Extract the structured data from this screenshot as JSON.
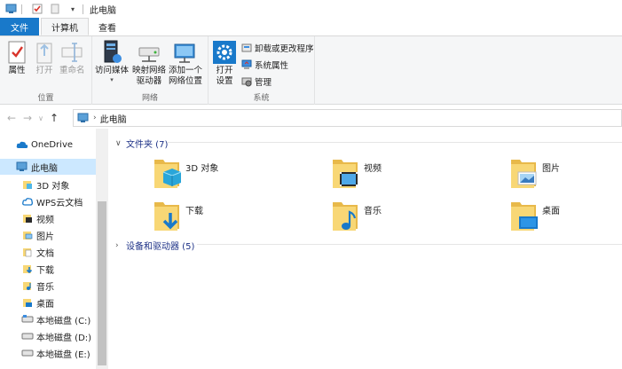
{
  "window": {
    "title": "此电脑"
  },
  "tabs": {
    "file": "文件",
    "computer": "计算机",
    "view": "查看"
  },
  "ribbon": {
    "location_group": {
      "label": "位置",
      "properties": "属性",
      "open": "打开",
      "rename": "重命名"
    },
    "network_group": {
      "label": "网络",
      "media": "访问媒体",
      "map_drive_line1": "映射网络",
      "map_drive_line2": "驱动器",
      "add_location_line1": "添加一个",
      "add_location_line2": "网络位置"
    },
    "system_group": {
      "label": "系统",
      "open_settings_line1": "打开",
      "open_settings_line2": "设置",
      "uninstall": "卸载或更改程序",
      "sys_props": "系统属性",
      "manage": "管理"
    }
  },
  "address": {
    "path": "此电脑"
  },
  "nav": {
    "onedrive": "OneDrive",
    "thispc": "此电脑",
    "items": [
      {
        "label": "3D 对象",
        "icon": "3d-objects-icon"
      },
      {
        "label": "WPS云文档",
        "icon": "wps-cloud-icon"
      },
      {
        "label": "视频",
        "icon": "videos-icon"
      },
      {
        "label": "图片",
        "icon": "pictures-icon"
      },
      {
        "label": "文档",
        "icon": "documents-icon"
      },
      {
        "label": "下载",
        "icon": "downloads-icon"
      },
      {
        "label": "音乐",
        "icon": "music-icon"
      },
      {
        "label": "桌面",
        "icon": "desktop-icon"
      },
      {
        "label": "本地磁盘 (C:)",
        "icon": "drive-icon"
      },
      {
        "label": "本地磁盘 (D:)",
        "icon": "drive-icon"
      },
      {
        "label": "本地磁盘 (E:)",
        "icon": "drive-icon"
      }
    ]
  },
  "content": {
    "folders_header": "文件夹 (7)",
    "folders": [
      {
        "name": "3D 对象",
        "icon": "3d-objects-folder-icon"
      },
      {
        "name": "视频",
        "icon": "videos-folder-icon"
      },
      {
        "name": "图片",
        "icon": "pictures-folder-icon"
      },
      {
        "name": "下载",
        "icon": "downloads-folder-icon"
      },
      {
        "name": "音乐",
        "icon": "music-folder-icon"
      },
      {
        "name": "桌面",
        "icon": "desktop-folder-icon"
      }
    ],
    "devices_header": "设备和驱动器 (5)"
  },
  "colors": {
    "accent": "#1979ca",
    "folder": "#f8d775",
    "selected": "#cce8ff",
    "header_text": "#1e3287"
  }
}
